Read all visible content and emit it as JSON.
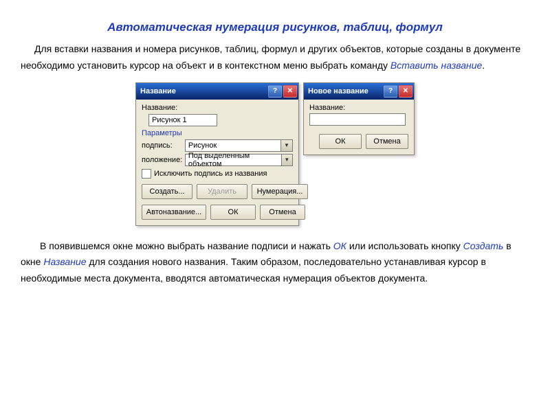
{
  "title": "Автоматическая нумерация рисунков, таблиц, формул",
  "para1_a": "Для вставки названия и номера рисунков, таблиц, формул и других объектов, которые созданы в документе необходимо установить курсор на объект и в контекстном меню выбрать команду ",
  "para1_cmd": "Вставить название",
  "para1_b": ".",
  "dlg1": {
    "title": "Название",
    "name_lbl": "Название:",
    "name_val": "Рисунок 1",
    "params_lbl": "Параметры",
    "caption_lbl": "подпись:",
    "caption_val": "Рисунок",
    "position_lbl": "положение:",
    "position_val": "Под выделенным объектом",
    "exclude_lbl": "Исключить подпись из названия",
    "btn_create": "Создать...",
    "btn_delete": "Удалить",
    "btn_numbering": "Нумерация...",
    "btn_autoname": "Автоназвание...",
    "btn_ok": "ОК",
    "btn_cancel": "Отмена"
  },
  "dlg2": {
    "title": "Новое название",
    "name_lbl": "Название:",
    "btn_ok": "ОК",
    "btn_cancel": "Отмена"
  },
  "para2_a": "В появившемся окне можно выбрать название подписи и нажать ",
  "para2_ok": "ОК",
  "para2_b": " или использовать кнопку ",
  "para2_create": "Создать",
  "para2_c": " в окне ",
  "para2_name": "Название",
  "para2_d": " для создания нового названия. Таким образом, последовательно устанавливая курсор в необходимые места документа, вводятся  автоматическая нумерация объектов документа."
}
